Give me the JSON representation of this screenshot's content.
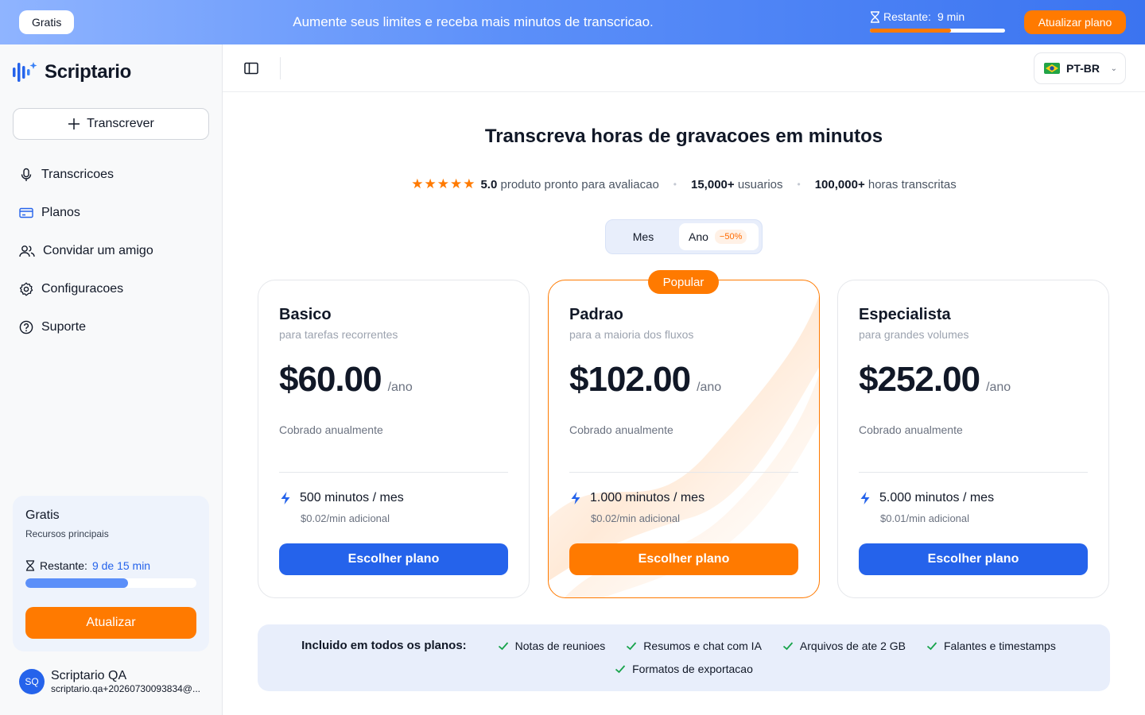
{
  "banner": {
    "plan_label": "Gratis",
    "promo": "Aumente seus limites e receba mais minutos de transcricao.",
    "remaining_label": "Restante:",
    "remaining_value": "9 min",
    "remaining_fraction": 0.6,
    "upgrade_label": "Atualizar plano"
  },
  "sidebar": {
    "brand": "Scriptario",
    "new_button": "Transcrever",
    "items": [
      {
        "label": "Transcricoes",
        "icon": "microphone-icon"
      },
      {
        "label": "Planos",
        "icon": "credit-card-icon"
      },
      {
        "label": "Convidar um amigo",
        "icon": "users-icon"
      },
      {
        "label": "Configuracoes",
        "icon": "gear-icon"
      },
      {
        "label": "Suporte",
        "icon": "help-circle-icon"
      }
    ],
    "plan_card": {
      "title": "Gratis",
      "subtitle": "Recursos principais",
      "remaining_label": "Restante:",
      "remaining_value": "9 de 15 min",
      "remaining_fraction": 0.6,
      "button": "Atualizar"
    },
    "user": {
      "initials": "SQ",
      "name": "Scriptario QA",
      "email": "scriptario.qa+20260730093834@..."
    }
  },
  "topbar": {
    "language": "PT-BR",
    "language_chevron": "⌄"
  },
  "hero": {
    "title": "Transcreva horas de gravacoes em minutos",
    "stars": "★★★★★",
    "rating": "5.0",
    "rating_text": "produto pronto para avaliacao",
    "users_count": "15,000+",
    "users_text": "usuarios",
    "hours_count": "100,000+",
    "hours_text": "horas transcritas",
    "separator": "•"
  },
  "billing_toggle": {
    "monthly": "Mes",
    "yearly": "Ano",
    "discount": "−50%",
    "selected": "yearly"
  },
  "plans": [
    {
      "name": "Basico",
      "desc": "para tarefas recorrentes",
      "price": "$60.00",
      "period": "/ano",
      "billed": "Cobrado anualmente",
      "minutes": "500 minutos / mes",
      "extra": "$0.02/min adicional",
      "button": "Escolher plano"
    },
    {
      "name": "Padrao",
      "desc": "para a maioria dos fluxos",
      "price": "$102.00",
      "period": "/ano",
      "billed": "Cobrado anualmente",
      "minutes": "1.000 minutos / mes",
      "extra": "$0.02/min adicional",
      "button": "Escolher plano",
      "tag": "Popular"
    },
    {
      "name": "Especialista",
      "desc": "para grandes volumes",
      "price": "$252.00",
      "period": "/ano",
      "billed": "Cobrado anualmente",
      "minutes": "5.000 minutos / mes",
      "extra": "$0.01/min adicional",
      "button": "Escolher plano"
    }
  ],
  "included": {
    "label": "Incluido em todos os planos:",
    "items": [
      "Notas de reunioes",
      "Resumos e chat com IA",
      "Arquivos de ate 2 GB",
      "Falantes e timestamps",
      "Formatos de exportacao"
    ]
  },
  "colors": {
    "accent_orange": "#ff7a00",
    "accent_blue": "#2563eb",
    "banner_gradient_end": "#3b74f0"
  }
}
